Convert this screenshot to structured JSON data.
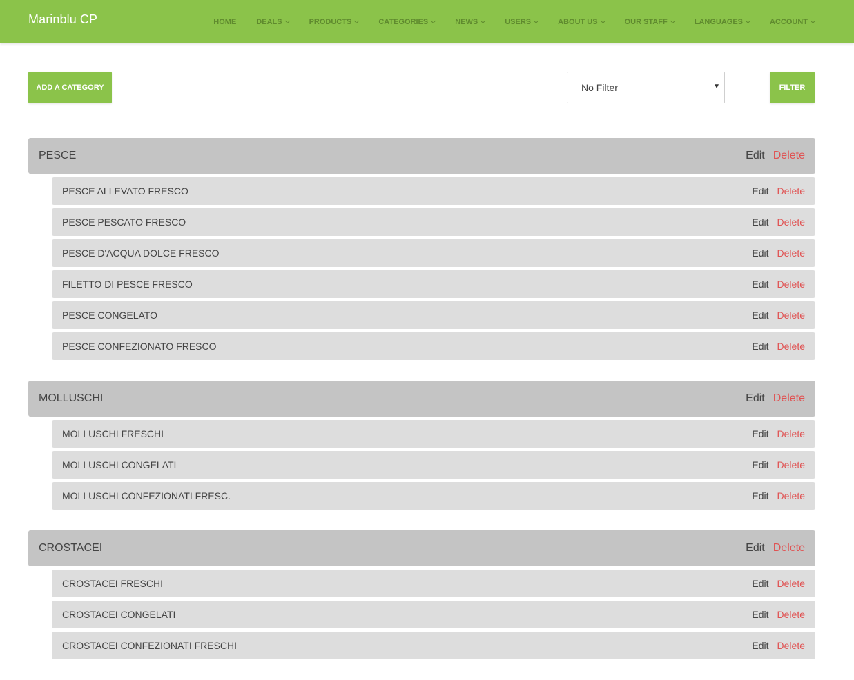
{
  "app": {
    "brand": "Marinblu CP"
  },
  "nav": {
    "items": [
      {
        "label": "HOME",
        "dropdown": false
      },
      {
        "label": "DEALS",
        "dropdown": true
      },
      {
        "label": "PRODUCTS",
        "dropdown": true
      },
      {
        "label": "CATEGORIES",
        "dropdown": true
      },
      {
        "label": "NEWS",
        "dropdown": true
      },
      {
        "label": "USERS",
        "dropdown": true
      },
      {
        "label": "ABOUT US",
        "dropdown": true
      },
      {
        "label": "OUR STAFF",
        "dropdown": true
      },
      {
        "label": "LANGUAGES",
        "dropdown": true
      },
      {
        "label": "ACCOUNT",
        "dropdown": true
      }
    ]
  },
  "toolbar": {
    "add_label": "ADD A CATEGORY",
    "filter_value": "No Filter",
    "filter_label": "FILTER"
  },
  "actions": {
    "edit": "Edit",
    "delete": "Delete"
  },
  "categories": [
    {
      "name": "PESCE",
      "children": [
        "PESCE ALLEVATO FRESCO",
        "PESCE PESCATO FRESCO",
        "PESCE D'ACQUA DOLCE FRESCO",
        "FILETTO DI PESCE FRESCO",
        "PESCE CONGELATO",
        "PESCE CONFEZIONATO FRESCO"
      ]
    },
    {
      "name": "MOLLUSCHI",
      "children": [
        "MOLLUSCHI FRESCHI",
        "MOLLUSCHI CONGELATI",
        "MOLLUSCHI CONFEZIONATI FRESC."
      ]
    },
    {
      "name": "CROSTACEI",
      "children": [
        "CROSTACEI FRESCHI",
        "CROSTACEI CONGELATI",
        "CROSTACEI CONFEZIONATI FRESCHI"
      ]
    }
  ],
  "colors": {
    "accent": "#8bc34a",
    "delete": "#e05252",
    "category_bg": "#c4c4c4",
    "subcategory_bg": "#dddddd"
  }
}
